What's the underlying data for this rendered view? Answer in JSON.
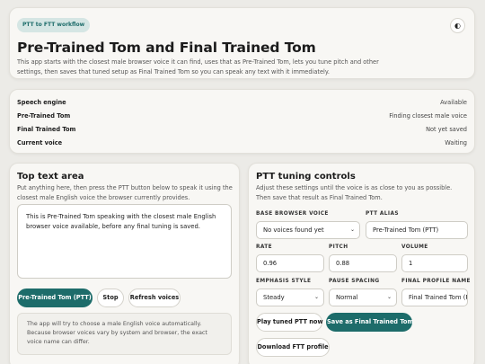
{
  "header": {
    "badge": "PTT to FTT workflow",
    "theme_toggle_glyph": "◐",
    "title": "Pre-Trained Tom and Final Trained Tom",
    "subtitle": "This app starts with the closest male browser voice it can find, uses that as Pre-Trained Tom, lets you tune pitch and other settings, then saves that tuned setup as Final Trained Tom so you can speak any text with it immediately."
  },
  "status": {
    "rows": [
      {
        "label": "Speech engine",
        "value": "Available"
      },
      {
        "label": "Pre-Trained Tom",
        "value": "Finding closest male voice"
      },
      {
        "label": "Final Trained Tom",
        "value": "Not yet saved"
      },
      {
        "label": "Current voice",
        "value": "Waiting"
      }
    ]
  },
  "text_area": {
    "title": "Top text area",
    "description": "Put anything here, then press the PTT button below to speak it using the closest male English voice the browser currently provides.",
    "value": "This is Pre-Trained Tom speaking with the closest male English browser voice available, before any final tuning is saved.",
    "buttons": {
      "speak": "Pre-Trained Tom (PTT)",
      "stop": "Stop",
      "refresh": "Refresh voices"
    },
    "note": "The app will try to choose a male English voice automatically. Because browser voices vary by system and browser, the exact voice name can differ."
  },
  "tuning": {
    "title": "PTT tuning controls",
    "description": "Adjust these settings until the voice is as close to you as possible. Then save that result as Final Trained Tom.",
    "base_voice": {
      "label": "BASE BROWSER VOICE",
      "value": "No voices found yet"
    },
    "alias": {
      "label": "PTT ALIAS",
      "value": "Pre-Trained Tom (PTT)"
    },
    "rate": {
      "label": "RATE",
      "value": "0.96"
    },
    "pitch": {
      "label": "PITCH",
      "value": "0.88"
    },
    "volume": {
      "label": "VOLUME",
      "value": "1"
    },
    "emphasis": {
      "label": "EMPHASIS STYLE",
      "value": "Steady"
    },
    "pause": {
      "label": "PAUSE SPACING",
      "value": "Normal"
    },
    "profile_name": {
      "label": "FINAL PROFILE NAME",
      "value": "Final Trained Tom (FTT)"
    },
    "buttons": {
      "play": "Play tuned PTT now",
      "save": "Save as Final Trained Tom",
      "download": "Download FTT profile"
    },
    "chevron_glyph": "⌄"
  },
  "colors": {
    "accent": "#1d6c6a",
    "badge_bg": "#d5e6e4",
    "page_bg": "#ecebe7",
    "card_bg": "#f8f7f4"
  }
}
